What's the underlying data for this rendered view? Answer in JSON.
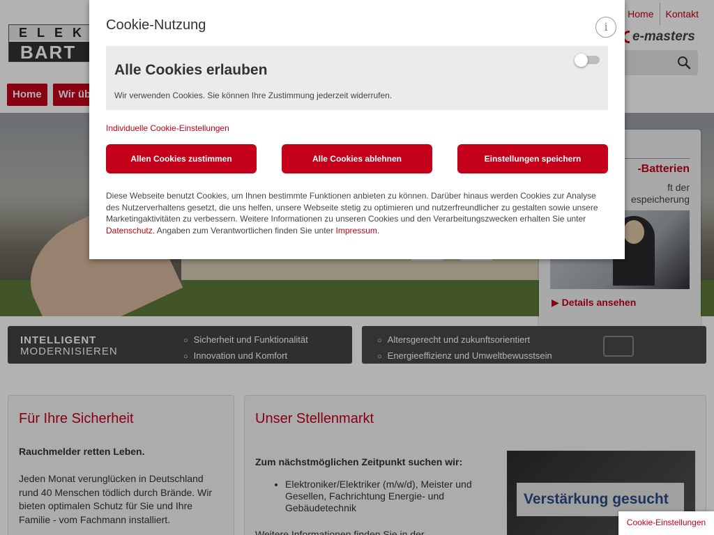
{
  "header": {
    "logo_top": "ELEK",
    "logo_bottom": "BART",
    "top_links": [
      "Home",
      "Kontakt"
    ],
    "partner_logo": "e-masters"
  },
  "nav": {
    "items": [
      "Home",
      "Wir üb"
    ]
  },
  "promo": {
    "title": "-Batterien",
    "text_line1": "ft der",
    "text_line2": "espeicherung",
    "link": "Details ansehen"
  },
  "banners": {
    "left_big_line1": "INTELLIGENT",
    "left_big_line2": "MODERNISIEREN",
    "left_bullets": [
      "Sicherheit und Funktionalität",
      "Innovation und Komfort"
    ],
    "right_bullets": [
      "Altersgerecht und zukunftsorientiert",
      "Energieeffizienz und Umweltbewusstsein"
    ]
  },
  "cards": {
    "left": {
      "title": "Für Ihre Sicherheit",
      "subtitle": "Rauchmelder retten Leben.",
      "body": "Jeden Monat verunglücken in Deutschland rund 40 Menschen tödlich durch Brände. Wir bieten optimalen Schutz für Sie und Ihre Familie - vom Fachmann installiert."
    },
    "right": {
      "title": "Unser Stellenmarkt",
      "intro": "Zum nächstmöglichen Zeitpunkt suchen wir:",
      "list": [
        "Elektroniker/Elektriker (m/w/d), Meister und Gesellen, Fachrichtung Energie- und Gebäudetechnik"
      ],
      "more": "Weitere Informationen finden Sie in der",
      "image_text": "Verstärkung gesucht"
    }
  },
  "cookie_modal": {
    "title": "Cookie-Nutzung",
    "info_icon_label": "i",
    "allow_title": "Alle Cookies erlauben",
    "allow_desc": "Wir verwenden Cookies. Sie können Ihre Zustimmung jederzeit widerrufen.",
    "toggle_state": "off",
    "individual_link": "Individuelle Cookie-Einstellungen",
    "buttons": {
      "accept_all": "Allen Cookies zustimmen",
      "reject_all": "Alle Cookies ablehnen",
      "save": "Einstellungen speichern"
    },
    "body_text": "Diese Webseite benutzt Cookies, um Ihnen bestimmte Funktionen anbieten zu können. Darüber hinaus werden Cookies zur Analyse des Nutzerverhaltens gesetzt, die uns helfen, unsere Webseite stetig zu optimieren und nutzerfreundlicher zu gestalten sowie unsere Marketingaktivitäten zu verbessern. Weitere Informationen zu unseren Cookies und den Verarbeitungszwecken erhalten Sie unter",
    "privacy_link": "Datenschutz",
    "body_text_2": ". Angaben zum Verantwortlichen finden Sie unter",
    "imprint_link": "Impressum",
    "body_end": "."
  },
  "cookie_settings_tab": "Cookie-Einstellungen",
  "colors": {
    "accent": "#c4001a",
    "panel": "#ebebeb"
  },
  "icons": [
    "search-icon",
    "info-icon",
    "play-icon",
    "caret-right-icon"
  ]
}
